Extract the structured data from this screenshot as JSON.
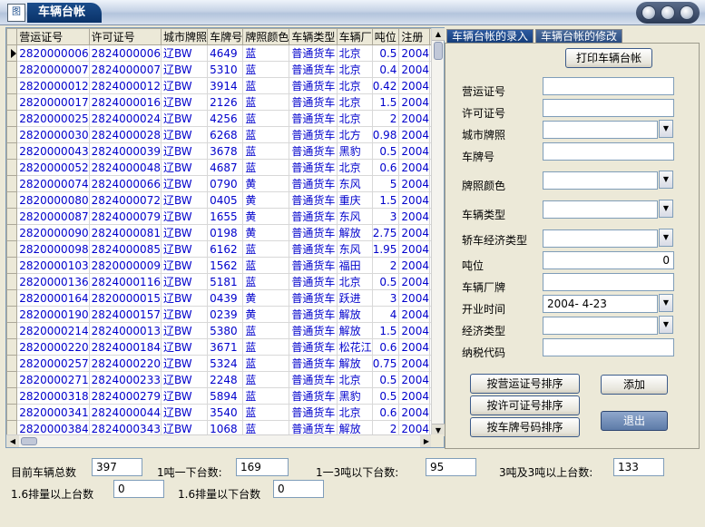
{
  "window": {
    "title": "车辆台帐",
    "icon_glyph": "图"
  },
  "grid": {
    "columns": [
      "营运证号",
      "许可证号",
      "城市牌照",
      "车牌号",
      "牌照颜色",
      "车辆类型",
      "车辆厂",
      "吨位",
      "注册"
    ],
    "rows": [
      [
        "2820000006",
        "2824000006",
        "辽BW",
        "4649",
        "蓝",
        "普通货车",
        "北京",
        "0.5",
        "2004"
      ],
      [
        "2820000007",
        "2824000007",
        "辽BW",
        "5310",
        "蓝",
        "普通货车",
        "北京",
        "0.4",
        "2004"
      ],
      [
        "2820000012",
        "2824000012",
        "辽BW",
        "3914",
        "蓝",
        "普通货车",
        "北京",
        "0.42",
        "2004"
      ],
      [
        "2820000017",
        "2824000016",
        "辽BW",
        "2126",
        "蓝",
        "普通货车",
        "北京",
        "1.5",
        "2004"
      ],
      [
        "2820000025",
        "2824000024",
        "辽BW",
        "4256",
        "蓝",
        "普通货车",
        "北京",
        "2",
        "2004"
      ],
      [
        "2820000030",
        "2824000028",
        "辽BW",
        "6268",
        "蓝",
        "普通货车",
        "北方",
        "0.98",
        "2004"
      ],
      [
        "2820000043",
        "2824000039",
        "辽BW",
        "3678",
        "蓝",
        "普通货车",
        "黑豹",
        "0.5",
        "2004"
      ],
      [
        "2820000052",
        "2824000048",
        "辽BW",
        "4687",
        "蓝",
        "普通货车",
        "北京",
        "0.6",
        "2004"
      ],
      [
        "2820000074",
        "2824000066",
        "辽BW",
        "0790",
        "黄",
        "普通货车",
        "东风",
        "5",
        "2004"
      ],
      [
        "2820000080",
        "2824000072",
        "辽BW",
        "0405",
        "黄",
        "普通货车",
        "重庆",
        "1.5",
        "2004"
      ],
      [
        "2820000087",
        "2824000079",
        "辽BW",
        "1655",
        "黄",
        "普通货车",
        "东风",
        "3",
        "2004"
      ],
      [
        "2820000090",
        "2824000081",
        "辽BW",
        "0198",
        "黄",
        "普通货车",
        "解放",
        "2.75",
        "2004"
      ],
      [
        "2820000098",
        "2824000085",
        "辽BW",
        "6162",
        "蓝",
        "普通货车",
        "东风",
        "1.95",
        "2004"
      ],
      [
        "2820000103",
        "2820000009",
        "辽BW",
        "1562",
        "蓝",
        "普通货车",
        "福田",
        "2",
        "2004"
      ],
      [
        "2820000136",
        "2824000116",
        "辽BW",
        "5181",
        "蓝",
        "普通货车",
        "北京",
        "0.5",
        "2004"
      ],
      [
        "2820000164",
        "2820000015",
        "辽BW",
        "0439",
        "黄",
        "普通货车",
        "跃进",
        "3",
        "2004"
      ],
      [
        "2820000190",
        "2824000157",
        "辽BW",
        "0239",
        "黄",
        "普通货车",
        "解放",
        "4",
        "2004"
      ],
      [
        "2820000214",
        "2824000013",
        "辽BW",
        "5380",
        "蓝",
        "普通货车",
        "解放",
        "1.5",
        "2004"
      ],
      [
        "2820000220",
        "2824000184",
        "辽BW",
        "3671",
        "蓝",
        "普通货车",
        "松花江",
        "0.6",
        "2004"
      ],
      [
        "2820000257",
        "2824000220",
        "辽BW",
        "5324",
        "蓝",
        "普通货车",
        "解放",
        "0.75",
        "2004"
      ],
      [
        "2820000271",
        "2824000233",
        "辽BW",
        "2248",
        "蓝",
        "普通货车",
        "北京",
        "0.5",
        "2004"
      ],
      [
        "2820000318",
        "2824000279",
        "辽BW",
        "5894",
        "蓝",
        "普通货车",
        "黑豹",
        "0.5",
        "2004"
      ],
      [
        "2820000341",
        "2824000044",
        "辽BW",
        "3540",
        "蓝",
        "普通货车",
        "北京",
        "0.6",
        "2004"
      ],
      [
        "2820000384",
        "2824000343",
        "辽BW",
        "1068",
        "蓝",
        "普通货车",
        "解放",
        "2",
        "2004"
      ]
    ]
  },
  "tabs": [
    {
      "label": "车辆台帐的录入"
    },
    {
      "label": "车辆台帐的修改"
    }
  ],
  "form": {
    "print_button": "打印车辆台帐",
    "fields": {
      "operating_cert": {
        "label": "营运证号",
        "value": ""
      },
      "license_cert": {
        "label": "许可证号",
        "value": ""
      },
      "city_plate": {
        "label": "城市牌照",
        "value": ""
      },
      "plate_no": {
        "label": "车牌号",
        "value": ""
      },
      "plate_color": {
        "label": "牌照颜色",
        "value": ""
      },
      "vehicle_type": {
        "label": "车辆类型",
        "value": ""
      },
      "econ_type_car": {
        "label": "轿车经济类型",
        "value": ""
      },
      "tonnage": {
        "label": "吨位",
        "value": "0"
      },
      "maker": {
        "label": "车辆厂牌",
        "value": ""
      },
      "open_date": {
        "label": "开业时间",
        "value": "2004- 4-23"
      },
      "econ_type": {
        "label": "经济类型",
        "value": ""
      },
      "tax_code": {
        "label": "纳税代码",
        "value": ""
      }
    },
    "sort_op_button": "按营运证号排序",
    "sort_lic_button": "按许可证号排序",
    "sort_plate_button": "按车牌号码排序",
    "add_button": "添加",
    "exit_button": "退出"
  },
  "stats": {
    "total_label": "目前车辆总数",
    "total_value": "397",
    "under1_label": "1吨一下台数:",
    "under1_value": "169",
    "1to3_label": "1一3吨以下台数:",
    "1to3_value": "95",
    "over3_label": "3吨及3吨以上台数:",
    "over3_value": "133",
    "over16_label": "1.6排量以上台数",
    "over16_value": "0",
    "under16_label": "1.6排量以下台数",
    "under16_value": "0"
  }
}
